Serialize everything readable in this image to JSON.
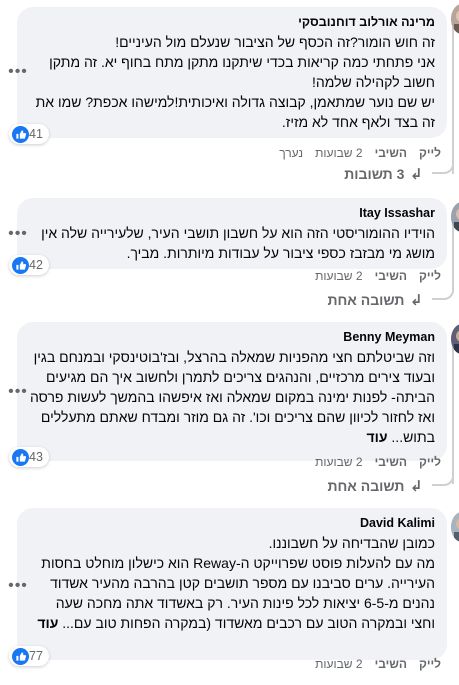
{
  "comments": [
    {
      "author": "מרינה אורלוב דוחנובסקי",
      "text": "זה חוש הומור?זה הכסף של הציבור שנעלם מול העיניים!\nאני פתחתי כמה קריאות בכדי שיתקנו מתקן מתח בחוף יא. זה מתקן חשוב לקהילה שלמה!\nיש שם נוער שמתאמן, קבוצה גדולה ואיכותית!למישהו אכפת? שמו את זה בצד ולאף אחד לא מזיז.",
      "more": "",
      "reactions": "41",
      "like": "לייק",
      "reply": "השיבי",
      "time": "2 שבועות",
      "edited": "נערך",
      "replies_label": "3 תשובות"
    },
    {
      "author": "Itay Issashar",
      "text": "הוידיו ההומוריסטי הזה הוא על חשבון תושבי העיר, שלעירייה שלה אין מושג מי מבזבז כספי ציבור על עבודות מיותרות. מביך.",
      "more": "",
      "reactions": "42",
      "like": "לייק",
      "reply": "השיבי",
      "time": "2 שבועות",
      "edited": "",
      "replies_label": "תשובה אחת"
    },
    {
      "author": "Benny Meyman",
      "text": "וזה שביטלתם חצי מהפניות שמאלה בהרצל, ובז'בוטינסקי ובמנחם בגין ובעוד צירים מרכזיים, והנהגים צריכים לתמרן ולחשוב איך הם מגיעים הביתה- לפנות ימינה במקום שמאלה ואז איפשהו בהמשך לעשות פרסה ואז לחזור לכיוון שהם צריכים וכו'. זה גם מוזר ומבדח שאתם מתעללים בתוש...",
      "more": "עוד",
      "reactions": "43",
      "like": "לייק",
      "reply": "השיבי",
      "time": "2 שבועות",
      "edited": "",
      "replies_label": "תשובה אחת"
    },
    {
      "author": "David Kalimi",
      "text": "כמובן שהבדיחה על חשבוננו.\nמה עם להעלות פוסט שפרוייקט ה-Reway הוא כישלון מוחלט בחסות העירייה. ערים סביבנו עם מספר תושבים קטן בהרבה מהעיר אשדוד נהנים מ-6-5 יציאות לכל פינות העיר. רק באשדוד אתה מחכה שעה וחצי ובמקרה הטוב עם רכבים מאשדוד (במקרה הפחות טוב עם...",
      "more": "עוד",
      "reactions": "77",
      "like": "לייק",
      "reply": "השיבי",
      "time": "2 שבועות",
      "edited": "",
      "replies_label": ""
    }
  ],
  "icons": {
    "more": "more-horizontal-icon",
    "like": "like-thumb-icon",
    "reply_arrow": "reply-arrow-icon"
  },
  "colors": {
    "bubble": "#f0f2f5",
    "like_blue": "#1877f2",
    "secondary_text": "#65676b"
  }
}
